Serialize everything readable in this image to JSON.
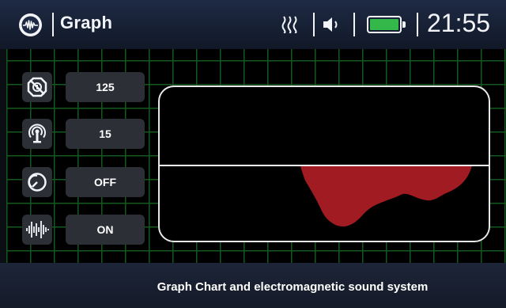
{
  "header": {
    "title": "Graph",
    "time": "21:55",
    "icons": {
      "app": "waveform-circle-icon",
      "signal": "signal-waves-icon",
      "volume": "speaker-icon",
      "battery": "battery-icon"
    },
    "battery_level": 1.0,
    "battery_color": "#35b84a"
  },
  "controls": [
    {
      "icon": "ground-balance-icon",
      "value": "125"
    },
    {
      "icon": "antenna-signal-icon",
      "value": "15"
    },
    {
      "icon": "rotation-dial-icon",
      "value": "OFF"
    },
    {
      "icon": "sound-wave-icon",
      "value": "ON"
    }
  ],
  "graph": {
    "fill_color": "#a01c22",
    "grid_color": "#145a1f"
  },
  "footer": {
    "text": "Graph Chart and electromagnetic sound system"
  }
}
